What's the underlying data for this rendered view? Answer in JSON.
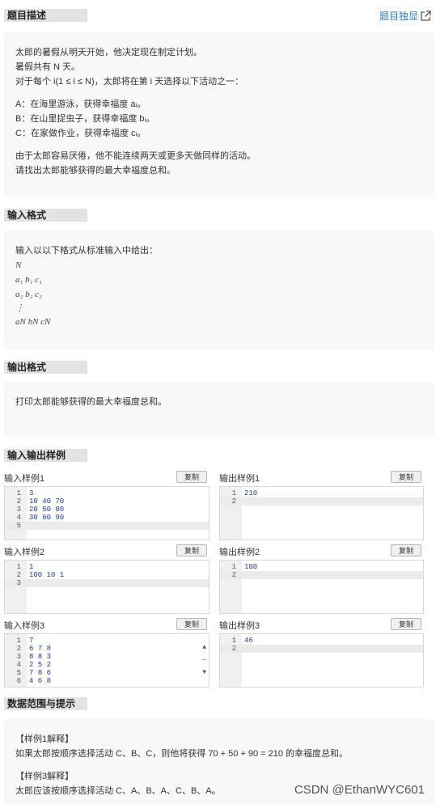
{
  "problem_desc": {
    "title": "题目描述",
    "lines": [
      "太郎的暑假从明天开始，他决定现在制定计划。",
      "暑假共有 N 天。",
      "对于每个 i(1 ≤ i ≤ N)，太郎将在第 i 天选择以下活动之一：",
      "A：在海里游泳，获得幸福度 aᵢ。",
      "B：在山里捉虫子，获得幸福度 bᵢ。",
      "C：在家做作业，获得幸福度 cᵢ。",
      "由于太郎容易厌倦，他不能连续两天或更多天做同样的活动。",
      "请找出太郎能够获得的最大幸福度总和。"
    ]
  },
  "topright": {
    "label": "题目独显",
    "icon": "external-link-icon"
  },
  "input_format": {
    "title": "输入格式",
    "lines": [
      "输入以以下格式从标准输入中给出：",
      "N",
      "a₁ b₁ c₁",
      "a₂ b₂ c₂",
      "⋮",
      "aN bN cN"
    ]
  },
  "output_format": {
    "title": "输出格式",
    "lines": [
      "打印太郎能够获得的最大幸福度总和。"
    ]
  },
  "samples": {
    "title": "输入输出样例",
    "copy_label": "复制",
    "items": [
      {
        "in_label": "输入样例1",
        "out_label": "输出样例1",
        "in_lines": [
          "3",
          "10 40 70",
          "20 50 80",
          "30 60 90",
          ""
        ],
        "out_lines": [
          "210",
          ""
        ]
      },
      {
        "in_label": "输入样例2",
        "out_label": "输出样例2",
        "in_lines": [
          "1",
          "100 10 1",
          ""
        ],
        "out_lines": [
          "100",
          ""
        ]
      },
      {
        "in_label": "输入样例3",
        "out_label": "输出样例3",
        "in_lines": [
          "7",
          "6 7 8",
          "8 8 3",
          "2 5 2",
          "7 8 6",
          "4 6 8"
        ],
        "out_lines": [
          "46",
          ""
        ]
      }
    ]
  },
  "hints": {
    "title": "数据范围与提示",
    "lines": [
      "【样例1解释】",
      "如果太郎按顺序选择活动 C、B、C，则他将获得 70 + 50 + 90 = 210 的幸福度总和。",
      "【样例3解释】",
      "太郎应该按顺序选择活动 C、A、B、A、C、B、A。"
    ]
  },
  "watermark": "CSDN @EthanWYC601"
}
